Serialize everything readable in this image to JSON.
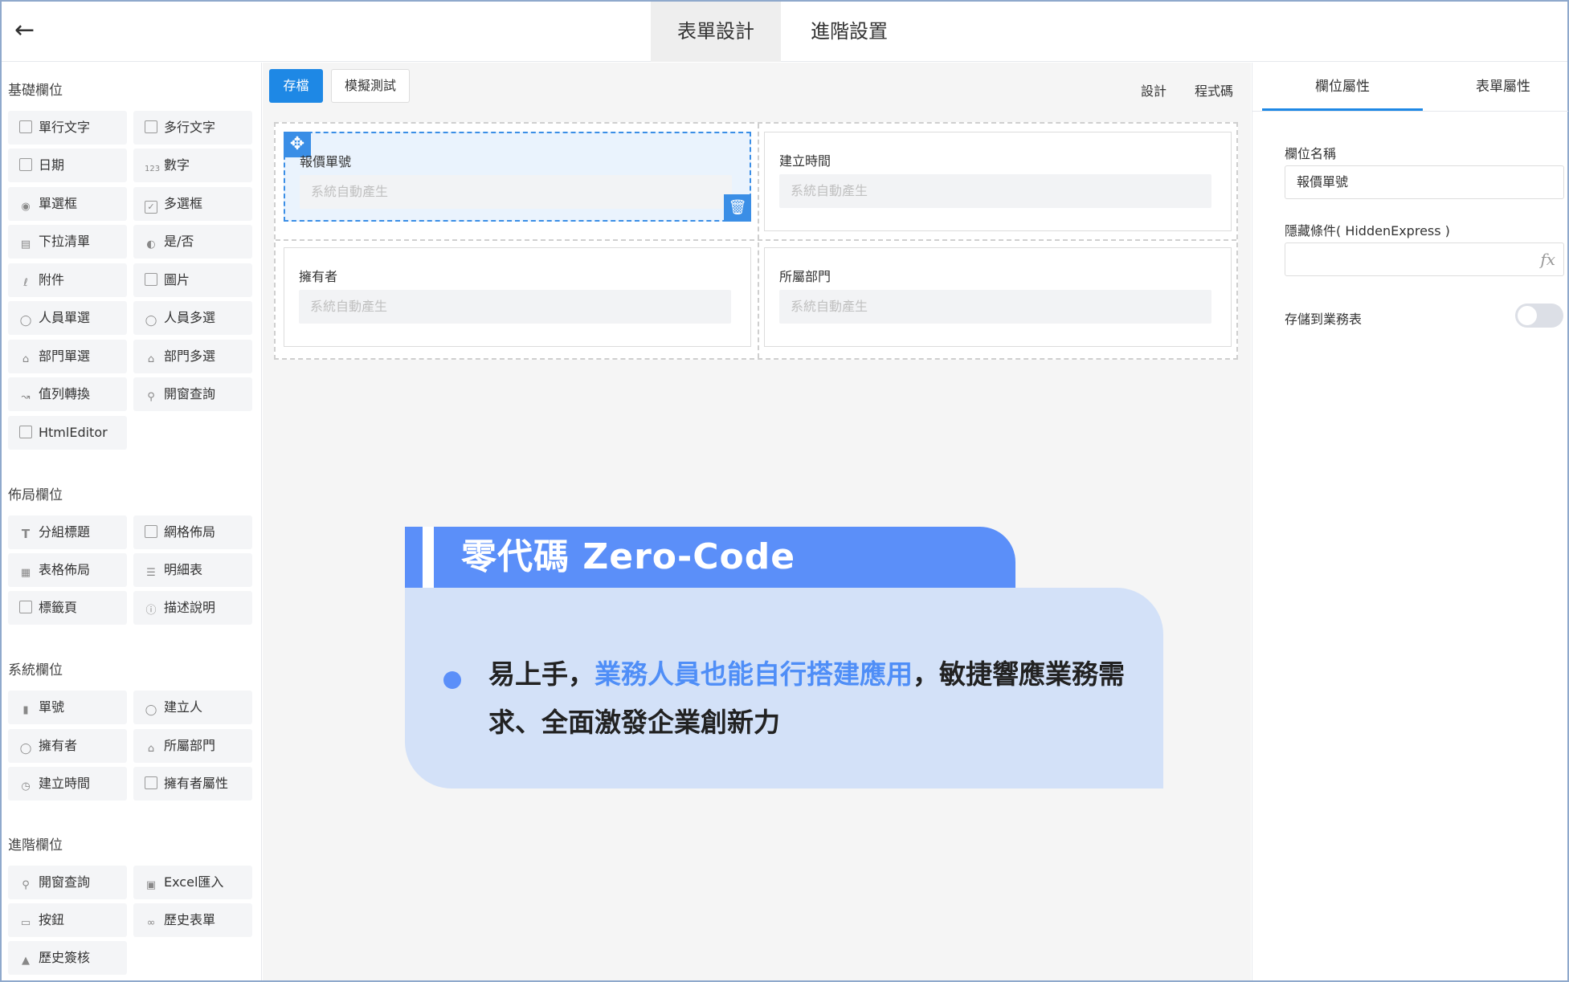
{
  "header": {
    "back_icon": "arrow-left-icon",
    "tabs": [
      {
        "label": "表單設計",
        "active": true
      },
      {
        "label": "進階設置",
        "active": false
      }
    ]
  },
  "sidebar": {
    "sections": [
      {
        "title": "基礎欄位",
        "items": [
          {
            "label": "單行文字",
            "icon": "single-line-icon"
          },
          {
            "label": "多行文字",
            "icon": "multi-line-icon"
          },
          {
            "label": "日期",
            "icon": "calendar-icon"
          },
          {
            "label": "數字",
            "icon": "number-icon"
          },
          {
            "label": "單選框",
            "icon": "radio-icon"
          },
          {
            "label": "多選框",
            "icon": "checkbox-icon"
          },
          {
            "label": "下拉清單",
            "icon": "dropdown-icon"
          },
          {
            "label": "是/否",
            "icon": "toggle-icon"
          },
          {
            "label": "附件",
            "icon": "paperclip-icon"
          },
          {
            "label": "圖片",
            "icon": "image-icon"
          },
          {
            "label": "人員單選",
            "icon": "user-icon"
          },
          {
            "label": "人員多選",
            "icon": "users-icon"
          },
          {
            "label": "部門單選",
            "icon": "department-icon"
          },
          {
            "label": "部門多選",
            "icon": "departments-icon"
          },
          {
            "label": "值列轉換",
            "icon": "transform-icon"
          },
          {
            "label": "開窗查詢",
            "icon": "search-icon"
          },
          {
            "label": "HtmlEditor",
            "icon": "editor-icon"
          }
        ]
      },
      {
        "title": "佈局欄位",
        "items": [
          {
            "label": "分組標題",
            "icon": "text-t-icon"
          },
          {
            "label": "網格佈局",
            "icon": "grid-icon"
          },
          {
            "label": "表格佈局",
            "icon": "table-icon"
          },
          {
            "label": "明細表",
            "icon": "list-icon"
          },
          {
            "label": "標籤頁",
            "icon": "folder-tab-icon"
          },
          {
            "label": "描述說明",
            "icon": "info-icon"
          }
        ]
      },
      {
        "title": "系統欄位",
        "items": [
          {
            "label": "單號",
            "icon": "barcode-icon"
          },
          {
            "label": "建立人",
            "icon": "user-icon"
          },
          {
            "label": "擁有者",
            "icon": "user-icon"
          },
          {
            "label": "所屬部門",
            "icon": "department-icon"
          },
          {
            "label": "建立時間",
            "icon": "clock-icon"
          },
          {
            "label": "擁有者屬性",
            "icon": "id-card-icon"
          }
        ]
      },
      {
        "title": "進階欄位",
        "items": [
          {
            "label": "開窗查詢",
            "icon": "search-icon"
          },
          {
            "label": "Excel匯入",
            "icon": "excel-icon"
          },
          {
            "label": "按鈕",
            "icon": "button-icon"
          },
          {
            "label": "歷史表單",
            "icon": "link-icon"
          },
          {
            "label": "歷史簽核",
            "icon": "stamp-icon"
          }
        ]
      }
    ]
  },
  "toolbar": {
    "save_label": "存檔",
    "simulate_label": "模擬測試",
    "design_label": "設計",
    "code_label": "程式碼"
  },
  "form": {
    "cells": [
      {
        "label": "報價單號",
        "placeholder": "系統自動產生",
        "selected": true
      },
      {
        "label": "建立時間",
        "placeholder": "系統自動產生",
        "selected": false
      },
      {
        "label": "擁有者",
        "placeholder": "系統自動產生",
        "selected": false
      },
      {
        "label": "所屬部門",
        "placeholder": "系統自動產生",
        "selected": false
      }
    ]
  },
  "banner": {
    "title": "零代碼 Zero-Code",
    "text_part1": "易上手，",
    "text_highlight": "業務人員也能自行搭建應用",
    "text_part2": "，敏捷響應業務需求、全面激發企業創新力"
  },
  "properties": {
    "tabs": [
      {
        "label": "欄位屬性",
        "active": true
      },
      {
        "label": "表單屬性",
        "active": false
      }
    ],
    "field_name_label": "欄位名稱",
    "field_name_value": "報價單號",
    "hidden_label": "隱藏條件( HiddenExpress )",
    "hidden_value": "",
    "fx_label": "fx",
    "store_label": "存儲到業務表",
    "store_enabled": false
  },
  "colors": {
    "primary": "#1e88e5",
    "banner_accent": "#5b8ff9",
    "banner_bg": "#d3e1f8",
    "highlight_text": "#4f8ef7"
  }
}
